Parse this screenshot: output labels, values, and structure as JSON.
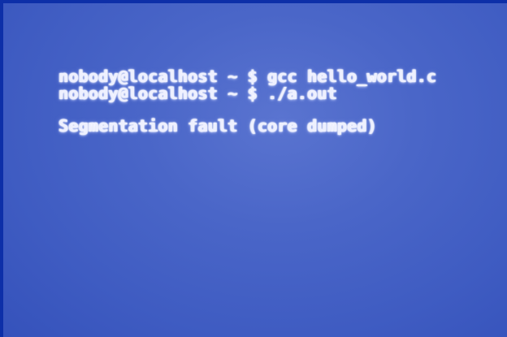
{
  "terminal": {
    "lines": [
      "nobody@localhost ~ $ gcc hello_world.c",
      "nobody@localhost ~ $ ./a.out",
      "Segmentation fault (core dumped)"
    ]
  },
  "colors": {
    "background": "#4a66c8",
    "text": "#eef0ff"
  }
}
